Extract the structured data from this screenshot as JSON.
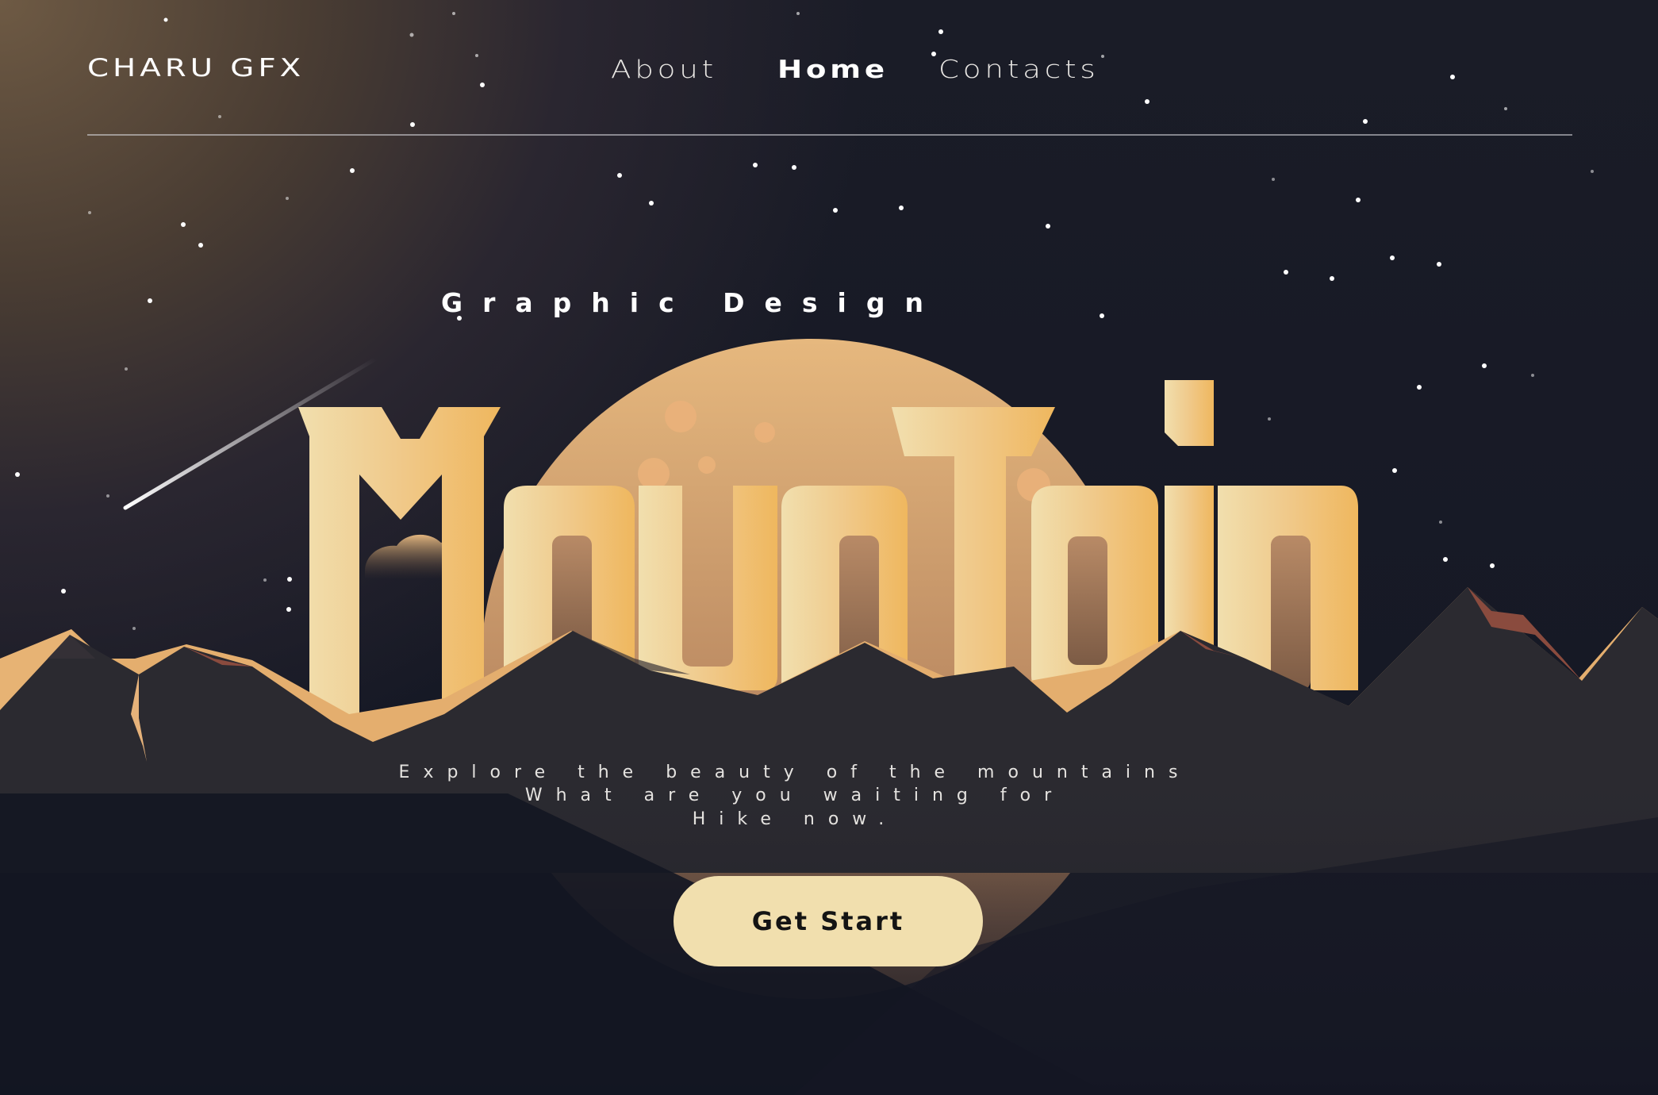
{
  "brand": {
    "name": "CHARU GFX"
  },
  "nav": {
    "items": [
      {
        "label": "About"
      },
      {
        "label": "Home"
      },
      {
        "label": "Contacts"
      }
    ],
    "active": "Home"
  },
  "hero": {
    "subtitle": "Graphic Design",
    "title": "MounTain",
    "tagline": [
      "Explore the beauty of the mountains",
      "What are you waiting for",
      "Hike now."
    ],
    "cta_label": "Get Start"
  },
  "colors": {
    "accent": "#f1dfae",
    "title_gradient_start": "#f1dfae",
    "title_gradient_end": "#efb75e",
    "moon": "#e8b97c",
    "background": "#131622",
    "mountain": "#2b2a30"
  }
}
